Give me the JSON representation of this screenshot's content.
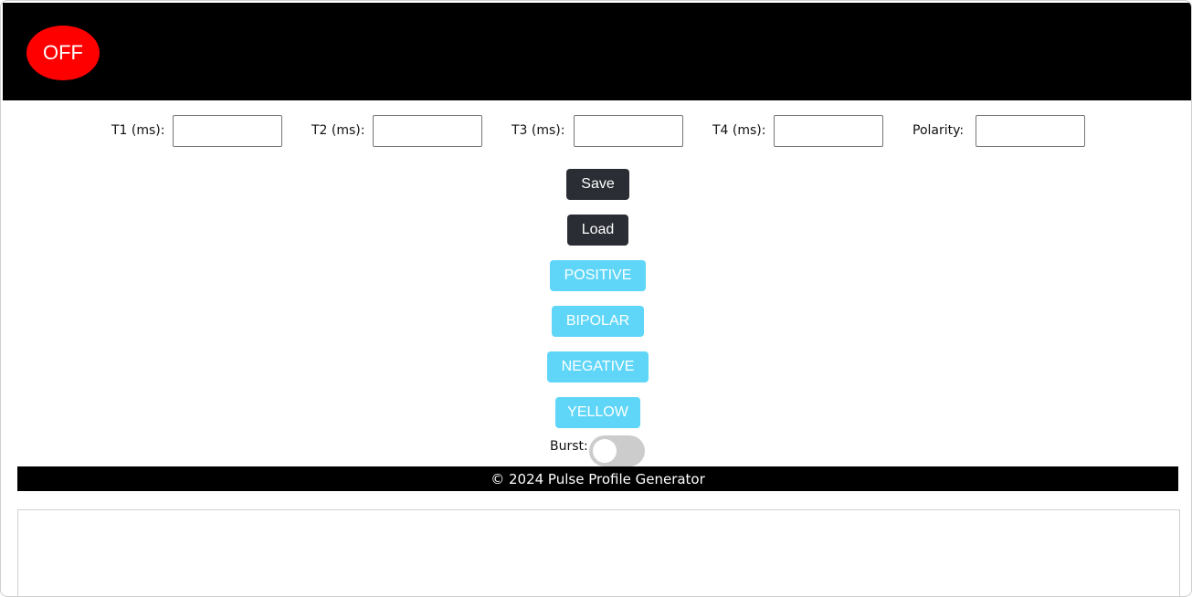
{
  "header": {
    "power_button_label": "OFF",
    "power_button_color": "#ff0000",
    "background_color": "#000000"
  },
  "params": {
    "t1_label": "T1 (ms):",
    "t1_value": "",
    "t2_label": "T2 (ms):",
    "t2_value": "",
    "t3_label": "T3 (ms):",
    "t3_value": "",
    "t4_label": "T4 (ms):",
    "t4_value": "",
    "polarity_label": "Polarity:",
    "polarity_value": ""
  },
  "actions": {
    "save_label": "Save",
    "load_label": "Load",
    "dark_button_color": "#2a2d34"
  },
  "polarity_buttons": {
    "positive_label": "POSITIVE",
    "bipolar_label": "BIPOLAR",
    "negative_label": "NEGATIVE",
    "yellow_label": "YELLOW",
    "button_color": "#5fd6f8"
  },
  "burst": {
    "label": "Burst:",
    "enabled": false
  },
  "footer": {
    "text": "© 2024 Pulse Profile Generator"
  }
}
